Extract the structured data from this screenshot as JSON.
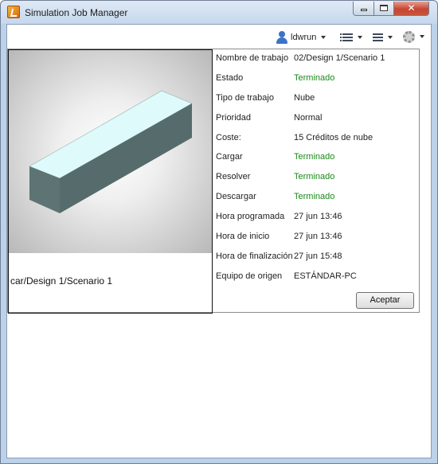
{
  "window": {
    "title": "Simulation Job Manager",
    "icon": "autodesk-simulation-icon",
    "controls": {
      "minimize": "minimize-icon",
      "maximize": "maximize-icon",
      "close": "✕"
    }
  },
  "toolbar": {
    "user_label": "ldwrun",
    "user_icon": "user-icon",
    "list_icon": "list-view-icon",
    "columns_icon": "columns-icon",
    "settings_icon": "gear-icon"
  },
  "job": {
    "scenario_path": "car/Design 1/Scenario 1",
    "properties": [
      {
        "label": "Nombre de trabajo",
        "value": "02/Design 1/Scenario 1",
        "status": false
      },
      {
        "label": "Estado",
        "value": "Terminado",
        "status": true
      },
      {
        "label": "Tipo de trabajo",
        "value": "Nube",
        "status": false
      },
      {
        "label": "Prioridad",
        "value": "Normal",
        "status": false
      },
      {
        "label": "Coste:",
        "value": "15 Créditos de nube",
        "status": false
      },
      {
        "label": "Cargar",
        "value": "Terminado",
        "status": true
      },
      {
        "label": "Resolver",
        "value": "Terminado",
        "status": true
      },
      {
        "label": "Descargar",
        "value": "Terminado",
        "status": true
      },
      {
        "label": "Hora programada",
        "value": "27 jun 13:46",
        "status": false
      },
      {
        "label": "Hora de inicio",
        "value": "27 jun 13:46",
        "status": false
      },
      {
        "label": "Hora de finalización",
        "value": "27 jun 15:48",
        "status": false
      },
      {
        "label": "Equipo de origen",
        "value": "ESTÁNDAR-PC",
        "status": false
      }
    ],
    "ok_label": "Aceptar"
  },
  "colors": {
    "status_ok": "#1b8a1b",
    "box_top": "#dffafa",
    "box_side": "#5b7070"
  }
}
